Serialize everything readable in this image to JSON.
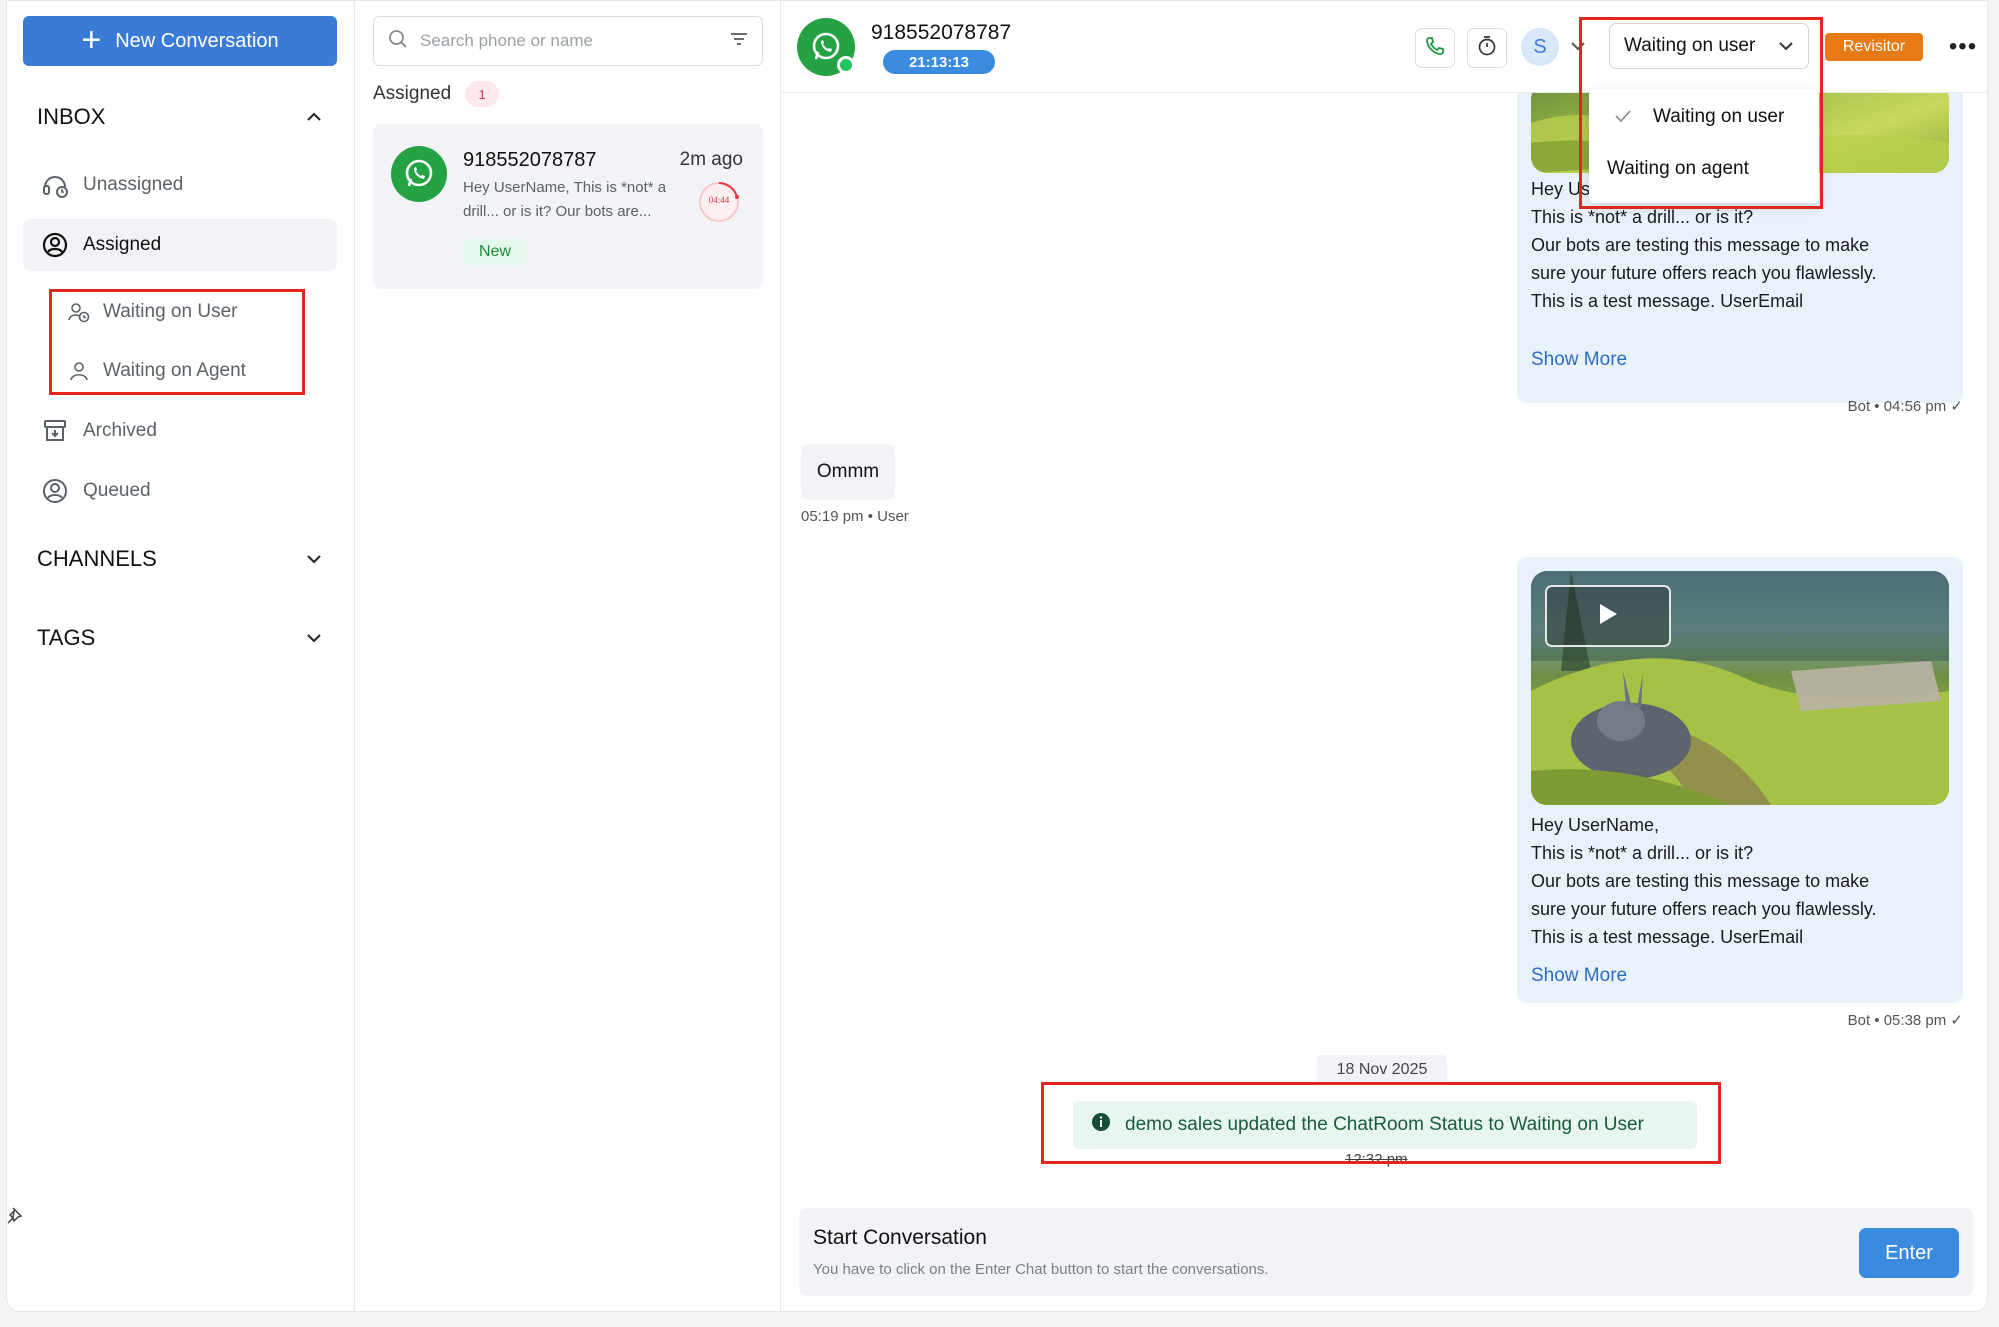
{
  "sidebar": {
    "new_conversation": "New Conversation",
    "inbox": "INBOX",
    "items": {
      "unassigned": "Unassigned",
      "assigned": "Assigned",
      "waiting_user": "Waiting on User",
      "waiting_agent": "Waiting on Agent",
      "archived": "Archived",
      "queued": "Queued"
    },
    "channels": "CHANNELS",
    "tags": "TAGS"
  },
  "list": {
    "search_placeholder": "Search phone or name",
    "section": "Assigned",
    "section_count": "1",
    "conversation": {
      "phone": "918552078787",
      "time_ago": "2m ago",
      "preview": "Hey UserName, This is *not* a drill... or is it? Our bots are...",
      "timer": "04:44",
      "tag": "New"
    }
  },
  "chat": {
    "phone": "918552078787",
    "timer": "21:13:13",
    "agent_initial": "S",
    "status": "Waiting on user",
    "status_options": [
      "Waiting on user",
      "Waiting on agent"
    ],
    "visitor_badge": "Revisitor",
    "messages": {
      "bot1": {
        "lines": [
          "Hey UserName,",
          "This is *not* a drill... or is it?",
          "Our bots are testing this message to make",
          "sure your future offers reach you flawlessly.",
          "This is a test message. UserEmail"
        ],
        "show_more": "Show More",
        "meta": "Bot • 04:56 pm ✓"
      },
      "user1": {
        "text": "Ommm",
        "meta": "05:19 pm • User"
      },
      "bot2": {
        "lines": [
          "Hey UserName,",
          "This is *not* a drill... or is it?",
          "Our bots are testing this message to make",
          "sure your future offers reach you flawlessly.",
          "This is a test message. UserEmail"
        ],
        "show_more": "Show More",
        "meta": "Bot • 05:38 pm ✓"
      }
    },
    "date_divider": "18 Nov 2025",
    "system_message": "demo sales updated the ChatRoom Status to Waiting on User",
    "system_time": "12:32 pm",
    "start": {
      "title": "Start Conversation",
      "subtitle": "You have to click on the Enter Chat button to start the conversations.",
      "button": "Enter"
    }
  },
  "colors": {
    "primary": "#3a7bd5",
    "whatsapp": "#25a244",
    "highlight": "#e0261f",
    "revisitor": "#e87a14"
  }
}
